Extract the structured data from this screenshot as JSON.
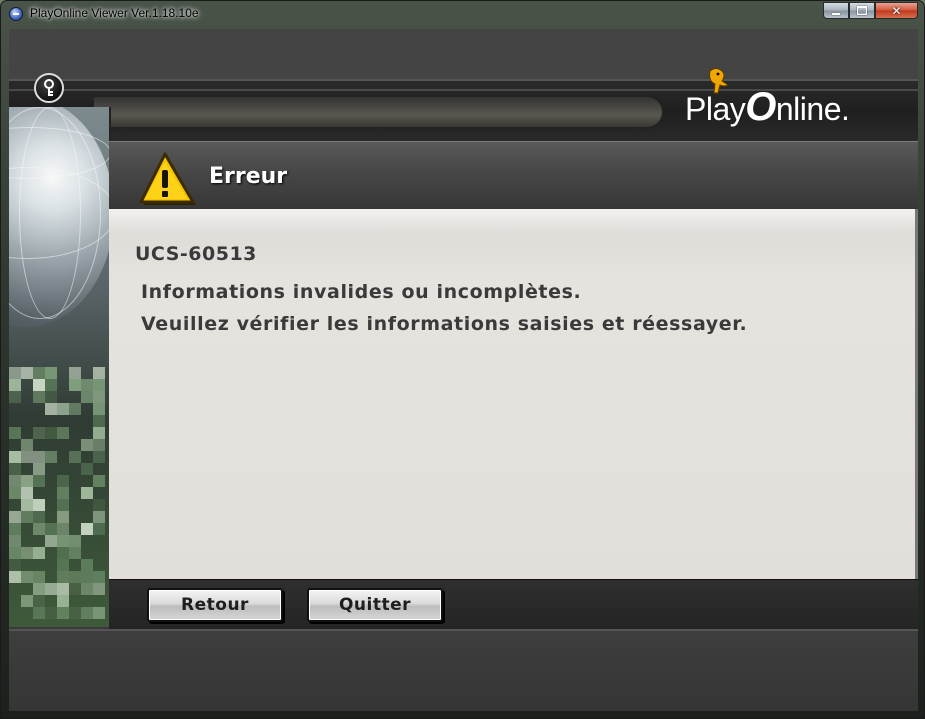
{
  "window": {
    "title": "PlayOnline Viewer Ver.1.18.10e",
    "minimize_label": "",
    "maximize_label": "",
    "close_label": "✕"
  },
  "header": {
    "logo_play": "Play",
    "logo_o": "O",
    "logo_rest": "nline."
  },
  "panel": {
    "title": "Erreur",
    "error_code": "UCS-60513",
    "message_line1": "Informations invalides ou incomplètes.",
    "message_line2": "Veuillez vérifier les informations saisies et réessayer."
  },
  "buttons": {
    "back_label": "Retour",
    "quit_label": "Quitter"
  },
  "colors": {
    "accent_warning": "#f5c400",
    "panel_background": "#e2dfdb",
    "text": "#3a3a3a"
  },
  "icons": {
    "app": "playonline-app-icon",
    "key": "key-icon",
    "warning": "warning-triangle-icon",
    "mascot": "chocobo-mascot-icon"
  }
}
